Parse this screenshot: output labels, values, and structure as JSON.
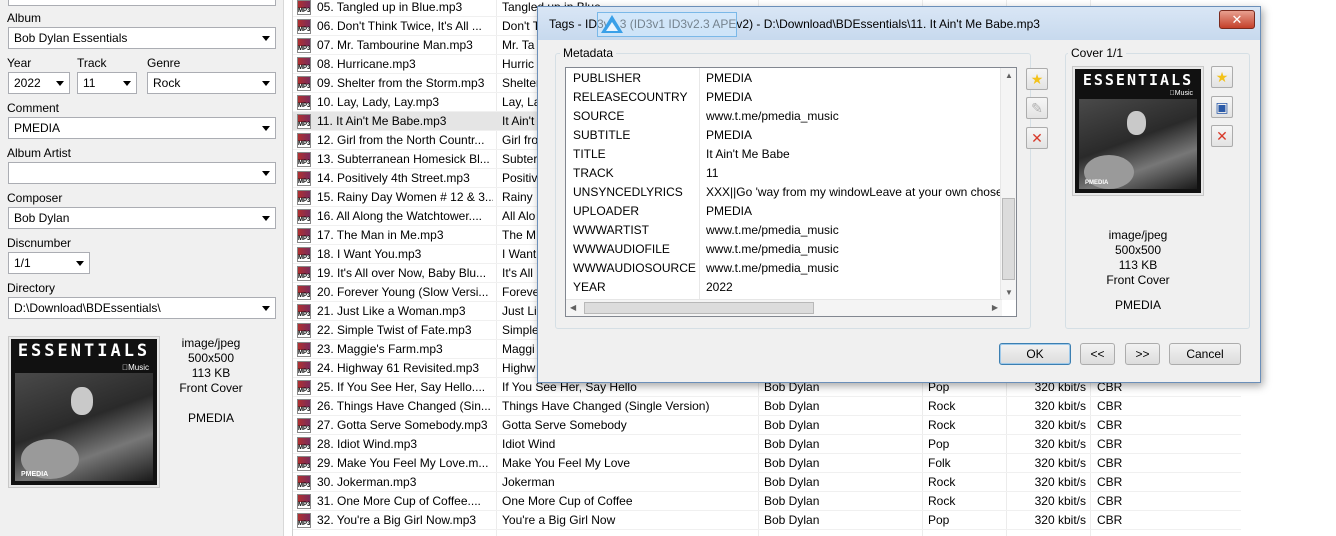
{
  "left_panel": {
    "album_label": "Album",
    "album_value": "Bob Dylan Essentials",
    "year_label": "Year",
    "year_value": "2022",
    "track_label": "Track",
    "track_value": "11",
    "genre_label": "Genre",
    "genre_value": "Rock",
    "comment_label": "Comment",
    "comment_value": "PMEDIA",
    "album_artist_label": "Album Artist",
    "album_artist_value": "",
    "composer_label": "Composer",
    "composer_value": "Bob Dylan",
    "discnumber_label": "Discnumber",
    "discnumber_value": "1/1",
    "directory_label": "Directory",
    "directory_value": "D:\\Download\\BDEssentials\\",
    "cover": {
      "art_title": "ESSENTIALS",
      "art_music": "Music",
      "art_logo": "PMEDIA",
      "mime": "image/jpeg",
      "dimensions": "500x500",
      "size": "113 KB",
      "type": "Front Cover",
      "description": "PMEDIA"
    }
  },
  "file_list": {
    "rows": [
      {
        "icon": "mp3-file-icon",
        "filename": "05. Tangled up in Blue.mp3",
        "title": "Tangled up in Blue",
        "artist": "",
        "genre": "",
        "bitrate": "",
        "mode": "",
        "selected": false
      },
      {
        "icon": "mp3-file-icon",
        "filename": "06. Don't Think Twice, It's All ...",
        "title": "Don't T",
        "artist": "",
        "genre": "",
        "bitrate": "",
        "mode": "",
        "selected": false
      },
      {
        "icon": "mp3-file-icon",
        "filename": "07. Mr. Tambourine Man.mp3",
        "title": "Mr. Ta",
        "artist": "",
        "genre": "",
        "bitrate": "",
        "mode": "",
        "selected": false
      },
      {
        "icon": "mp3-file-icon",
        "filename": "08. Hurricane.mp3",
        "title": "Hurric",
        "artist": "",
        "genre": "",
        "bitrate": "",
        "mode": "",
        "selected": false
      },
      {
        "icon": "mp3-file-icon",
        "filename": "09. Shelter from the Storm.mp3",
        "title": "Shelter",
        "artist": "",
        "genre": "",
        "bitrate": "",
        "mode": "",
        "selected": false
      },
      {
        "icon": "mp3-file-icon",
        "filename": "10. Lay, Lady, Lay.mp3",
        "title": "Lay, La",
        "artist": "",
        "genre": "",
        "bitrate": "",
        "mode": "",
        "selected": false
      },
      {
        "icon": "mp3-file-icon",
        "filename": "11. It Ain't Me Babe.mp3",
        "title": "It Ain't",
        "artist": "",
        "genre": "",
        "bitrate": "",
        "mode": "",
        "selected": true
      },
      {
        "icon": "mp3-file-icon",
        "filename": "12. Girl from the North Countr...",
        "title": "Girl fro",
        "artist": "",
        "genre": "",
        "bitrate": "",
        "mode": "",
        "selected": false
      },
      {
        "icon": "mp3-file-icon",
        "filename": "13. Subterranean Homesick Bl...",
        "title": "Subter",
        "artist": "",
        "genre": "",
        "bitrate": "",
        "mode": "",
        "selected": false
      },
      {
        "icon": "mp3-file-icon",
        "filename": "14. Positively 4th Street.mp3",
        "title": "Positiv",
        "artist": "",
        "genre": "",
        "bitrate": "",
        "mode": "",
        "selected": false
      },
      {
        "icon": "mp3-file-icon",
        "filename": "15. Rainy Day Women # 12 & 3...",
        "title": "Rainy",
        "artist": "",
        "genre": "",
        "bitrate": "",
        "mode": "",
        "selected": false
      },
      {
        "icon": "mp3-file-icon",
        "filename": "16. All Along the Watchtower....",
        "title": "All Alo",
        "artist": "",
        "genre": "",
        "bitrate": "",
        "mode": "",
        "selected": false
      },
      {
        "icon": "mp3-file-icon",
        "filename": "17. The Man in Me.mp3",
        "title": "The M",
        "artist": "",
        "genre": "",
        "bitrate": "",
        "mode": "",
        "selected": false
      },
      {
        "icon": "mp3-file-icon",
        "filename": "18. I Want You.mp3",
        "title": "I Want",
        "artist": "",
        "genre": "",
        "bitrate": "",
        "mode": "",
        "selected": false
      },
      {
        "icon": "mp3-file-icon",
        "filename": "19. It's All over Now, Baby Blu...",
        "title": "It's All",
        "artist": "",
        "genre": "",
        "bitrate": "",
        "mode": "",
        "selected": false
      },
      {
        "icon": "mp3-file-icon",
        "filename": "20. Forever Young (Slow Versi...",
        "title": "Foreve",
        "artist": "",
        "genre": "",
        "bitrate": "",
        "mode": "",
        "selected": false
      },
      {
        "icon": "mp3-file-icon",
        "filename": "21. Just Like a Woman.mp3",
        "title": "Just Li",
        "artist": "",
        "genre": "",
        "bitrate": "",
        "mode": "",
        "selected": false
      },
      {
        "icon": "mp3-file-icon",
        "filename": "22. Simple Twist of Fate.mp3",
        "title": "Simple",
        "artist": "",
        "genre": "",
        "bitrate": "",
        "mode": "",
        "selected": false
      },
      {
        "icon": "mp3-file-icon",
        "filename": "23. Maggie's Farm.mp3",
        "title": "Maggi",
        "artist": "",
        "genre": "",
        "bitrate": "",
        "mode": "",
        "selected": false
      },
      {
        "icon": "mp3-file-icon",
        "filename": "24. Highway 61 Revisited.mp3",
        "title": "Highw",
        "artist": "",
        "genre": "",
        "bitrate": "",
        "mode": "",
        "selected": false
      },
      {
        "icon": "mp3-file-icon",
        "filename": "25. If You See Her, Say Hello....",
        "title": "If You See Her, Say Hello",
        "artist": "Bob Dylan",
        "genre": "Pop",
        "bitrate": "320 kbit/s",
        "mode": "CBR",
        "selected": false
      },
      {
        "icon": "mp3-file-icon",
        "filename": "26. Things Have Changed (Sin...",
        "title": "Things Have Changed (Single Version)",
        "artist": "Bob Dylan",
        "genre": "Rock",
        "bitrate": "320 kbit/s",
        "mode": "CBR",
        "selected": false
      },
      {
        "icon": "mp3-file-icon",
        "filename": "27. Gotta Serve Somebody.mp3",
        "title": "Gotta Serve Somebody",
        "artist": "Bob Dylan",
        "genre": "Rock",
        "bitrate": "320 kbit/s",
        "mode": "CBR",
        "selected": false
      },
      {
        "icon": "mp3-file-icon",
        "filename": "28. Idiot Wind.mp3",
        "title": "Idiot Wind",
        "artist": "Bob Dylan",
        "genre": "Pop",
        "bitrate": "320 kbit/s",
        "mode": "CBR",
        "selected": false
      },
      {
        "icon": "mp3-file-icon",
        "filename": "29. Make You Feel My Love.m...",
        "title": "Make You Feel My Love",
        "artist": "Bob Dylan",
        "genre": "Folk",
        "bitrate": "320 kbit/s",
        "mode": "CBR",
        "selected": false
      },
      {
        "icon": "mp3-file-icon",
        "filename": "30. Jokerman.mp3",
        "title": "Jokerman",
        "artist": "Bob Dylan",
        "genre": "Rock",
        "bitrate": "320 kbit/s",
        "mode": "CBR",
        "selected": false
      },
      {
        "icon": "mp3-file-icon",
        "filename": "31. One More Cup of Coffee....",
        "title": "One More Cup of Coffee",
        "artist": "Bob Dylan",
        "genre": "Rock",
        "bitrate": "320 kbit/s",
        "mode": "CBR",
        "selected": false
      },
      {
        "icon": "mp3-file-icon",
        "filename": "32. You're a Big Girl Now.mp3",
        "title": "You're a Big Girl Now",
        "artist": "Bob Dylan",
        "genre": "Pop",
        "bitrate": "320 kbit/s",
        "mode": "CBR",
        "selected": false
      }
    ]
  },
  "dialog": {
    "title": "Tags - ID3v1.3 (ID3v1 ID3v2.3 APEv2) - D:\\Download\\BDEssentials\\11. It Ain't Me Babe.mp3",
    "close_glyph": "✕",
    "watermark_text": "",
    "metadata_group_label": "Metadata",
    "cover_group_label": "Cover 1/1",
    "metadata_rows": [
      {
        "key": "PUBLISHER",
        "value": "PMEDIA"
      },
      {
        "key": "RELEASECOUNTRY",
        "value": "PMEDIA"
      },
      {
        "key": "SOURCE",
        "value": "www.t.me/pmedia_music"
      },
      {
        "key": "SUBTITLE",
        "value": "PMEDIA"
      },
      {
        "key": "TITLE",
        "value": "It Ain't Me Babe"
      },
      {
        "key": "TRACK",
        "value": "11"
      },
      {
        "key": "UNSYNCEDLYRICS",
        "value": "XXX||Go 'way from my windowLeave at your own chose"
      },
      {
        "key": "UPLOADER",
        "value": "PMEDIA"
      },
      {
        "key": "WWWARTIST",
        "value": "www.t.me/pmedia_music"
      },
      {
        "key": "WWWAUDIOFILE",
        "value": "www.t.me/pmedia_music"
      },
      {
        "key": "WWWAUDIOSOURCE",
        "value": "www.t.me/pmedia_music"
      },
      {
        "key": "YEAR",
        "value": "2022"
      }
    ],
    "cover": {
      "art_title": "ESSENTIALS",
      "art_music": "Music",
      "art_logo": "PMEDIA",
      "mime": "image/jpeg",
      "dimensions": "500x500",
      "size": "113 KB",
      "type": "Front Cover",
      "description": "PMEDIA"
    },
    "buttons": {
      "ok": "OK",
      "prev": "<<",
      "next": ">>",
      "cancel": "Cancel"
    },
    "icon_glyphs": {
      "add": "★",
      "edit": "✎",
      "delete": "✕",
      "save": "▣"
    }
  },
  "colors": {
    "selection": "#e5e5e5",
    "panel": "#f0f0f0",
    "titlebar": "#c7d9ee",
    "delete_red": "#d83a2a",
    "add_yellow": "#f3c21a",
    "save_blue": "#2a5aa8"
  }
}
